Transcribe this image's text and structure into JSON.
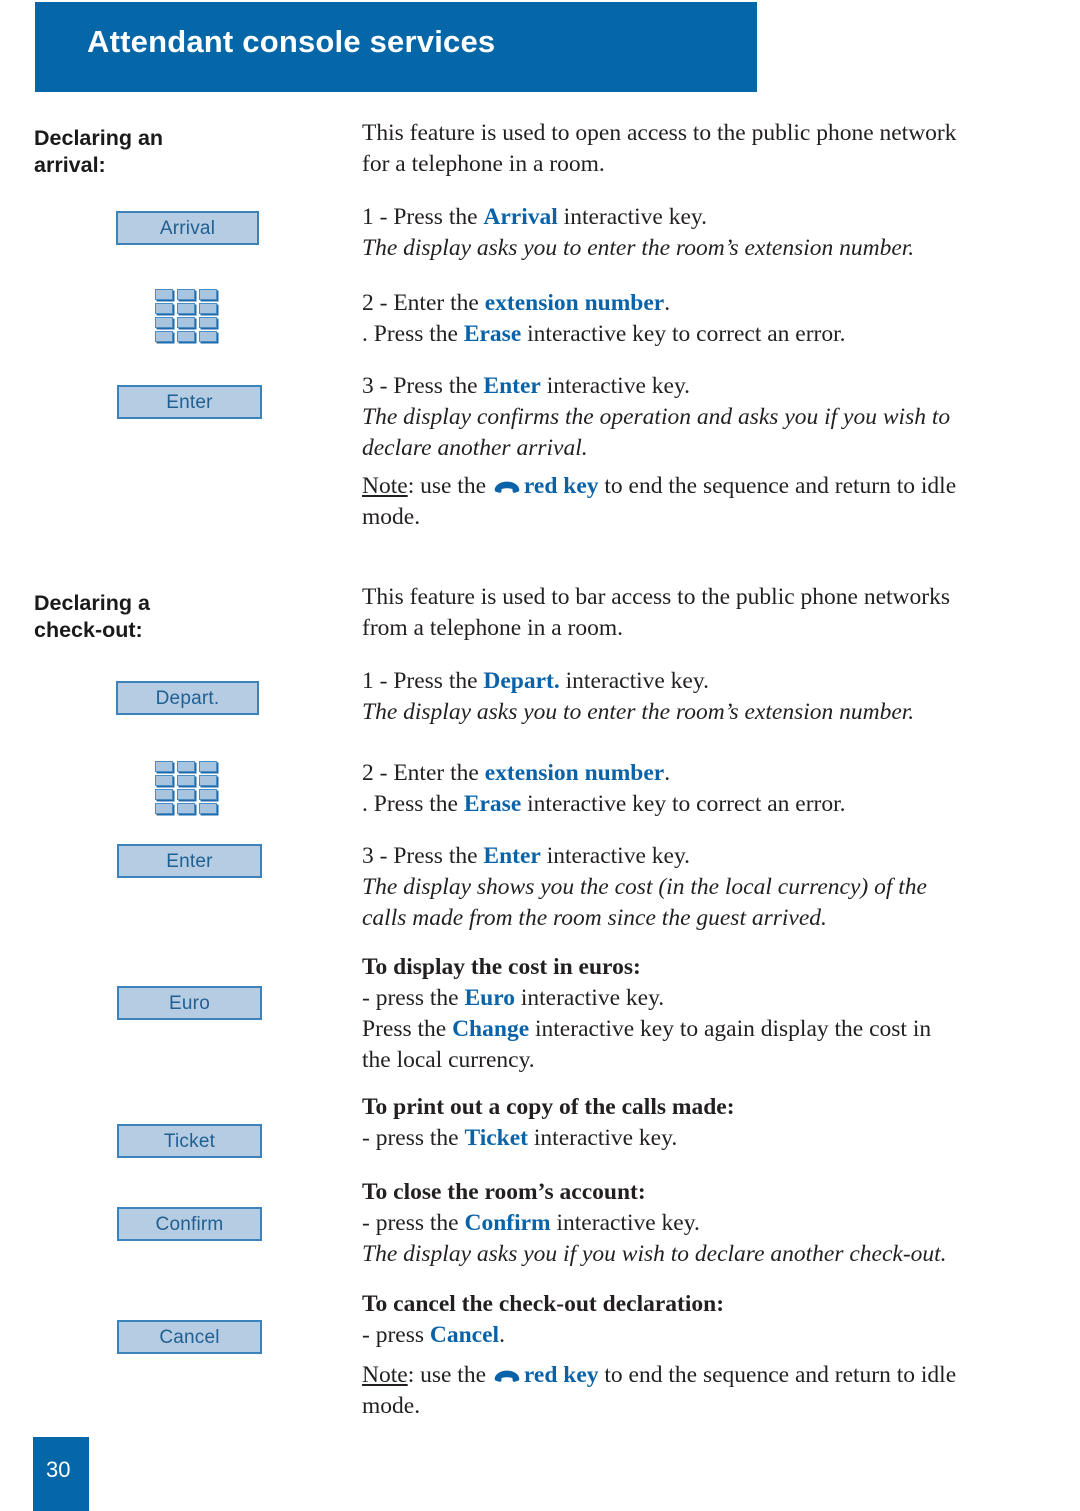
{
  "header": {
    "title": "Attendant console services"
  },
  "sections": [
    {
      "heading": "Declaring an\narrival:",
      "heading_line1": "Declaring an",
      "heading_line2": "arrival:"
    },
    {
      "heading_line1": "Declaring a",
      "heading_line2": "check-out:"
    }
  ],
  "softkeys": {
    "arrival": "Arrival",
    "enter_1": "Enter",
    "depart": "Depart.",
    "enter_2": "Enter",
    "euro": "Euro",
    "ticket": "Ticket",
    "confirm": "Confirm",
    "cancel": "Cancel"
  },
  "icons": {
    "keypad": "keypad-icon",
    "red_key": "hangup-handset-icon"
  },
  "section1": {
    "intro_line1": "This feature is used to open access to the public phone network",
    "intro_line2": "for a telephone in a room.",
    "step1_prefix": "1 - Press the ",
    "step1_key": "Arrival",
    "step1_suffix": " interactive key.",
    "step1_note": "The display asks you to enter the room’s extension number.",
    "step2_prefix": "2 - Enter the ",
    "step2_key": "extension number",
    "step2_suffix": ".",
    "step2_line2_prefix": ". Press the ",
    "step2_line2_key": "Erase",
    "step2_line2_suffix": " interactive key to correct an error.",
    "step3_prefix": "3 - Press the ",
    "step3_key": "Enter",
    "step3_suffix": " interactive key.",
    "step3_note_line1": "The display confirms the operation and asks you if you wish to",
    "step3_note_line2": "declare another arrival.",
    "note_label": "Note",
    "note_prefix": ": use the ",
    "note_key": "red key",
    "note_suffix_line1": " to end the sequence and return to idle",
    "note_suffix_line2": "mode."
  },
  "section2": {
    "intro_line1": "This feature is used to bar access to the public phone networks",
    "intro_line2": "from a telephone in a room.",
    "step1_prefix": "1 - Press the ",
    "step1_key": "Depart.",
    "step1_suffix": " interactive key.",
    "step1_note": "The display asks you to enter the room’s extension number.",
    "step2_prefix": "2 - Enter the ",
    "step2_key": "extension number",
    "step2_suffix": ".",
    "step2_line2_prefix": ". Press the ",
    "step2_line2_key": "Erase",
    "step2_line2_suffix": " interactive key to correct an error.",
    "step3_prefix": "3 - Press the ",
    "step3_key": "Enter",
    "step3_suffix": " interactive key.",
    "step3_note_line1": "The display shows you the cost (in the local currency) of the",
    "step3_note_line2": "calls made from the room since the guest arrived.",
    "euro_heading": "To display the cost in euros:",
    "euro_prefix": "- press the ",
    "euro_key": "Euro",
    "euro_suffix": " interactive key.",
    "change_prefix": "Press the ",
    "change_key": "Change",
    "change_suffix_line1": " interactive key to again display the cost in",
    "change_suffix_line2": "the local currency.",
    "ticket_heading": "To print out a copy of the calls made:",
    "ticket_prefix": "- press the ",
    "ticket_key": "Ticket",
    "ticket_suffix": " interactive key.",
    "confirm_heading": "To close the room’s account:",
    "confirm_prefix": "- press the ",
    "confirm_key": "Confirm",
    "confirm_suffix": " interactive key.",
    "confirm_note": "The display asks you if you wish to declare another check-out.",
    "cancel_heading": "To cancel the check-out declaration:",
    "cancel_prefix": "- press ",
    "cancel_key": "Cancel",
    "cancel_suffix": ".",
    "note_label": "Note",
    "note_prefix": ": use the ",
    "note_key": "red key",
    "note_suffix_line1": " to end the sequence and return to idle",
    "note_suffix_line2": "mode."
  },
  "footer": {
    "page_number": "30"
  },
  "colors": {
    "brand_blue": "#0566a8",
    "highlight_blue": "#0a63a8",
    "softkey_fill": "#b6cce2",
    "softkey_border": "#3c82bb",
    "softkey_text": "#1f5f92"
  }
}
